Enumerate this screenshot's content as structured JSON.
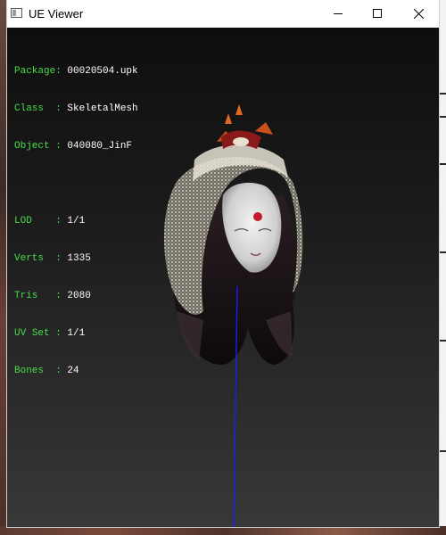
{
  "window": {
    "title": "UE Viewer",
    "buttons": {
      "minimize": "minimize",
      "maximize": "maximize",
      "close": "close"
    }
  },
  "info": {
    "package_label": "Package:",
    "package_value": "00020504.upk",
    "class_label": "Class  :",
    "class_value": "SkeletalMesh",
    "object_label": "Object :",
    "object_value": "040080_JinF",
    "lod_label": "LOD    :",
    "lod_value": "1/1",
    "verts_label": "Verts  :",
    "verts_value": "1335",
    "tris_label": "Tris   :",
    "tris_value": "2080",
    "uvset_label": "UV Set :",
    "uvset_value": "1/1",
    "bones_label": "Bones  :",
    "bones_value": "24"
  },
  "colors": {
    "label_green": "#4ade4a",
    "value_white": "#ffffff",
    "axis_blue": "#1a1aff",
    "viewport_top": "#0e0e0e",
    "viewport_bottom": "#383838"
  },
  "icons": [
    "app-window-icon",
    "minimize-icon",
    "maximize-icon",
    "close-icon"
  ]
}
